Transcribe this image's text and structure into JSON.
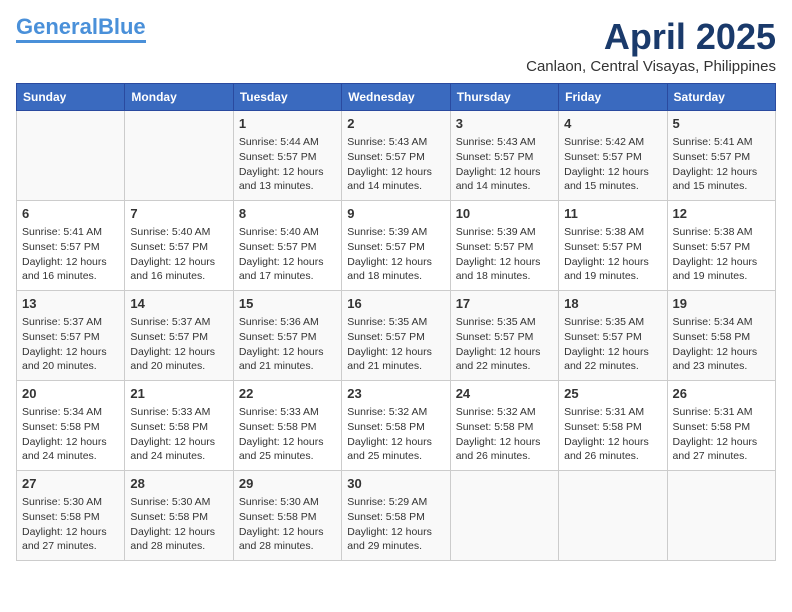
{
  "logo": {
    "line1": "General",
    "line2": "Blue"
  },
  "title": "April 2025",
  "location": "Canlaon, Central Visayas, Philippines",
  "headers": [
    "Sunday",
    "Monday",
    "Tuesday",
    "Wednesday",
    "Thursday",
    "Friday",
    "Saturday"
  ],
  "weeks": [
    [
      {
        "day": "",
        "content": ""
      },
      {
        "day": "",
        "content": ""
      },
      {
        "day": "1",
        "content": "Sunrise: 5:44 AM\nSunset: 5:57 PM\nDaylight: 12 hours\nand 13 minutes."
      },
      {
        "day": "2",
        "content": "Sunrise: 5:43 AM\nSunset: 5:57 PM\nDaylight: 12 hours\nand 14 minutes."
      },
      {
        "day": "3",
        "content": "Sunrise: 5:43 AM\nSunset: 5:57 PM\nDaylight: 12 hours\nand 14 minutes."
      },
      {
        "day": "4",
        "content": "Sunrise: 5:42 AM\nSunset: 5:57 PM\nDaylight: 12 hours\nand 15 minutes."
      },
      {
        "day": "5",
        "content": "Sunrise: 5:41 AM\nSunset: 5:57 PM\nDaylight: 12 hours\nand 15 minutes."
      }
    ],
    [
      {
        "day": "6",
        "content": "Sunrise: 5:41 AM\nSunset: 5:57 PM\nDaylight: 12 hours\nand 16 minutes."
      },
      {
        "day": "7",
        "content": "Sunrise: 5:40 AM\nSunset: 5:57 PM\nDaylight: 12 hours\nand 16 minutes."
      },
      {
        "day": "8",
        "content": "Sunrise: 5:40 AM\nSunset: 5:57 PM\nDaylight: 12 hours\nand 17 minutes."
      },
      {
        "day": "9",
        "content": "Sunrise: 5:39 AM\nSunset: 5:57 PM\nDaylight: 12 hours\nand 18 minutes."
      },
      {
        "day": "10",
        "content": "Sunrise: 5:39 AM\nSunset: 5:57 PM\nDaylight: 12 hours\nand 18 minutes."
      },
      {
        "day": "11",
        "content": "Sunrise: 5:38 AM\nSunset: 5:57 PM\nDaylight: 12 hours\nand 19 minutes."
      },
      {
        "day": "12",
        "content": "Sunrise: 5:38 AM\nSunset: 5:57 PM\nDaylight: 12 hours\nand 19 minutes."
      }
    ],
    [
      {
        "day": "13",
        "content": "Sunrise: 5:37 AM\nSunset: 5:57 PM\nDaylight: 12 hours\nand 20 minutes."
      },
      {
        "day": "14",
        "content": "Sunrise: 5:37 AM\nSunset: 5:57 PM\nDaylight: 12 hours\nand 20 minutes."
      },
      {
        "day": "15",
        "content": "Sunrise: 5:36 AM\nSunset: 5:57 PM\nDaylight: 12 hours\nand 21 minutes."
      },
      {
        "day": "16",
        "content": "Sunrise: 5:35 AM\nSunset: 5:57 PM\nDaylight: 12 hours\nand 21 minutes."
      },
      {
        "day": "17",
        "content": "Sunrise: 5:35 AM\nSunset: 5:57 PM\nDaylight: 12 hours\nand 22 minutes."
      },
      {
        "day": "18",
        "content": "Sunrise: 5:35 AM\nSunset: 5:57 PM\nDaylight: 12 hours\nand 22 minutes."
      },
      {
        "day": "19",
        "content": "Sunrise: 5:34 AM\nSunset: 5:58 PM\nDaylight: 12 hours\nand 23 minutes."
      }
    ],
    [
      {
        "day": "20",
        "content": "Sunrise: 5:34 AM\nSunset: 5:58 PM\nDaylight: 12 hours\nand 24 minutes."
      },
      {
        "day": "21",
        "content": "Sunrise: 5:33 AM\nSunset: 5:58 PM\nDaylight: 12 hours\nand 24 minutes."
      },
      {
        "day": "22",
        "content": "Sunrise: 5:33 AM\nSunset: 5:58 PM\nDaylight: 12 hours\nand 25 minutes."
      },
      {
        "day": "23",
        "content": "Sunrise: 5:32 AM\nSunset: 5:58 PM\nDaylight: 12 hours\nand 25 minutes."
      },
      {
        "day": "24",
        "content": "Sunrise: 5:32 AM\nSunset: 5:58 PM\nDaylight: 12 hours\nand 26 minutes."
      },
      {
        "day": "25",
        "content": "Sunrise: 5:31 AM\nSunset: 5:58 PM\nDaylight: 12 hours\nand 26 minutes."
      },
      {
        "day": "26",
        "content": "Sunrise: 5:31 AM\nSunset: 5:58 PM\nDaylight: 12 hours\nand 27 minutes."
      }
    ],
    [
      {
        "day": "27",
        "content": "Sunrise: 5:30 AM\nSunset: 5:58 PM\nDaylight: 12 hours\nand 27 minutes."
      },
      {
        "day": "28",
        "content": "Sunrise: 5:30 AM\nSunset: 5:58 PM\nDaylight: 12 hours\nand 28 minutes."
      },
      {
        "day": "29",
        "content": "Sunrise: 5:30 AM\nSunset: 5:58 PM\nDaylight: 12 hours\nand 28 minutes."
      },
      {
        "day": "30",
        "content": "Sunrise: 5:29 AM\nSunset: 5:58 PM\nDaylight: 12 hours\nand 29 minutes."
      },
      {
        "day": "",
        "content": ""
      },
      {
        "day": "",
        "content": ""
      },
      {
        "day": "",
        "content": ""
      }
    ]
  ]
}
